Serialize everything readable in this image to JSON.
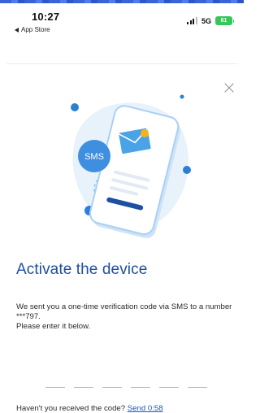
{
  "status_bar": {
    "time": "10:27",
    "back_label": "App Store",
    "network": "5G",
    "battery": "61"
  },
  "illustration": {
    "badge": "SMS"
  },
  "colors": {
    "title": "#1d4fa3",
    "link": "#1a55c0",
    "accent_dot": "#2b7fd6",
    "envelope": "#4aa3e6",
    "notification": "#f5b21b",
    "battery": "#35c759"
  },
  "icons": {
    "close": "close-icon",
    "back": "back-arrow-icon",
    "envelope": "envelope-icon"
  },
  "content": {
    "title": "Activate the device",
    "description_line1": "We sent you a one-time verification code via SMS to a number ***797.",
    "description_line2": "Please enter it below.",
    "code_slots": [
      "",
      "",
      "",
      "",
      "",
      ""
    ],
    "resend_prompt": "Haven't you received the code?",
    "resend_link": "Send 0:58"
  }
}
